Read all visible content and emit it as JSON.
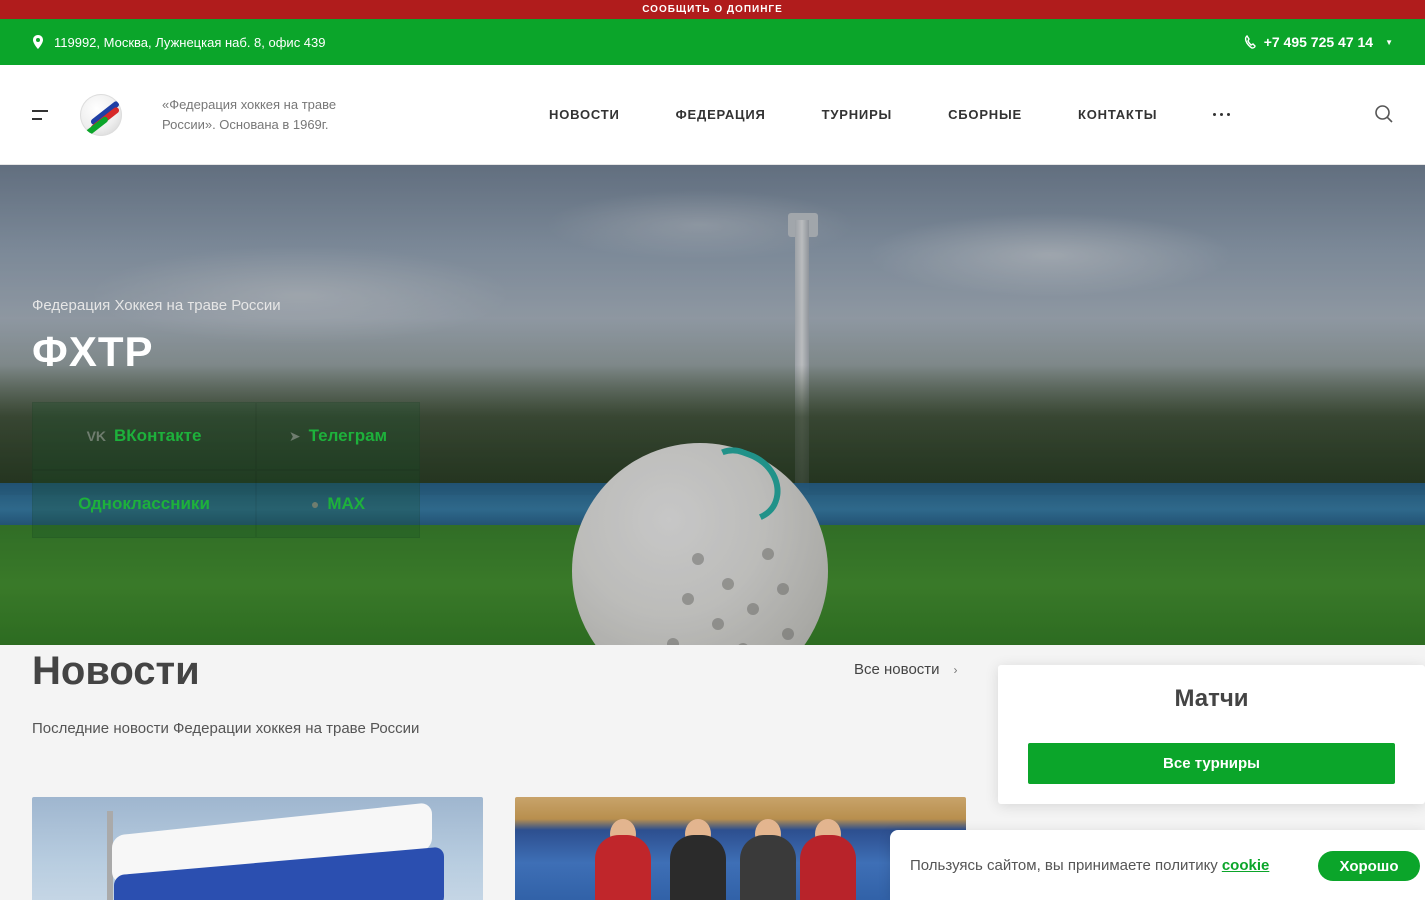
{
  "topbar": {
    "report_doping": "СООБЩИТЬ О ДОПИНГЕ"
  },
  "contacts": {
    "address": "119992, Москва, Лужнецкая наб. 8, офис 439",
    "phone": "+7 495 725 47 14"
  },
  "header": {
    "tagline": "«Федерация хоккея на траве России». Основана в 1969г.",
    "nav": [
      "НОВОСТИ",
      "ФЕДЕРАЦИЯ",
      "ТУРНИРЫ",
      "СБОРНЫЕ",
      "КОНТАКТЫ"
    ]
  },
  "hero": {
    "subtitle": "Федерация Хоккея на траве России",
    "title": "ФХТР",
    "socials": [
      "ВКонтакте",
      "Телеграм",
      "Одноклассники",
      "MAX"
    ]
  },
  "news": {
    "title": "Новости",
    "all_link": "Все новости",
    "subtitle": "Последние новости Федерации хоккея на траве России"
  },
  "matches": {
    "title": "Матчи",
    "button": "Все турниры"
  },
  "cookie": {
    "text": "Пользуясь сайтом, вы принимаете политику",
    "link": "cookie",
    "button": "Хорошо"
  },
  "colors": {
    "brand_green": "#0ba52a",
    "alert_red": "#b01c1c"
  }
}
